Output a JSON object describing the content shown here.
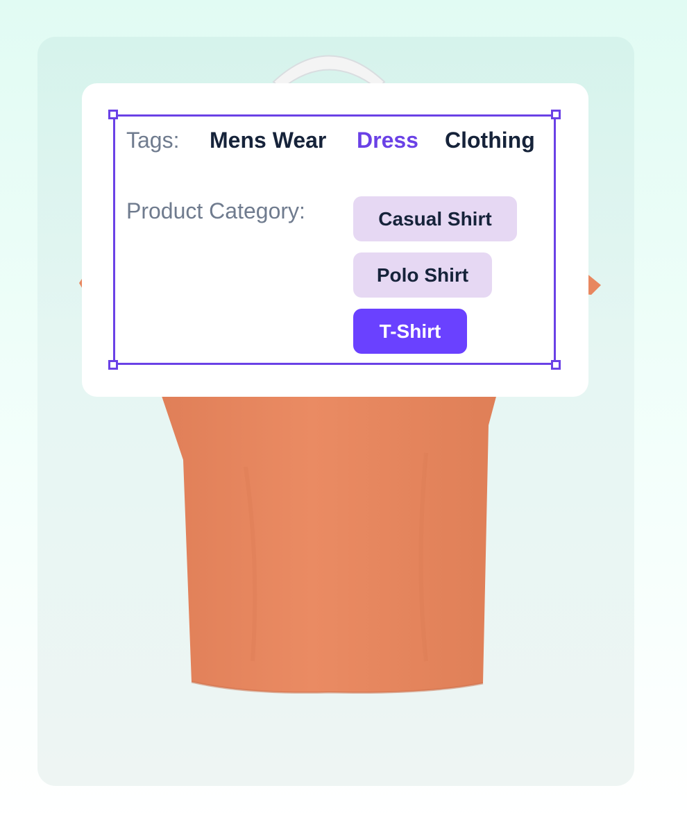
{
  "colors": {
    "accent": "#6a41e6",
    "selected_chip": "#6a41ff",
    "chip_background": "#e6d8f3",
    "label_text": "#6f7b8e",
    "dark_text": "#16233a",
    "shirt": "#e8875f"
  },
  "tags": {
    "label": "Tags:",
    "items": [
      {
        "label": "Mens Wear",
        "selected": false
      },
      {
        "label": "Dress",
        "selected": true
      },
      {
        "label": "Clothing",
        "selected": false
      }
    ]
  },
  "product_category": {
    "label": "Product Category:",
    "options": [
      {
        "label": "Casual Shirt",
        "selected": false
      },
      {
        "label": "Polo Shirt",
        "selected": false
      },
      {
        "label": "T-Shirt",
        "selected": true
      }
    ]
  }
}
